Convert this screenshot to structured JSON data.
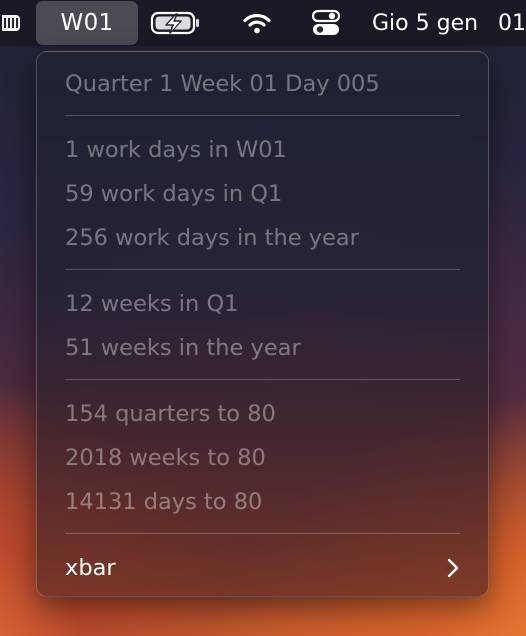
{
  "menubar": {
    "left_icon": "bars-icon",
    "week_item": "W01",
    "battery_icon": "battery-charging-icon",
    "wifi_icon": "wifi-icon",
    "control_center_icon": "control-center-icon",
    "date": "Gio 5 gen",
    "time_partial": "01"
  },
  "menu": {
    "header": "Quarter 1 Week 01 Day 005",
    "work_days": [
      "1 work days in W01",
      "59 work days in Q1",
      "256 work days in the year"
    ],
    "weeks": [
      "12 weeks in Q1",
      "51 weeks in the year"
    ],
    "to_80": [
      "154 quarters to 80",
      "2018 weeks to 80",
      "14131 days to 80"
    ],
    "xbar": {
      "label": "xbar",
      "icon": "chevron-right-icon"
    }
  }
}
